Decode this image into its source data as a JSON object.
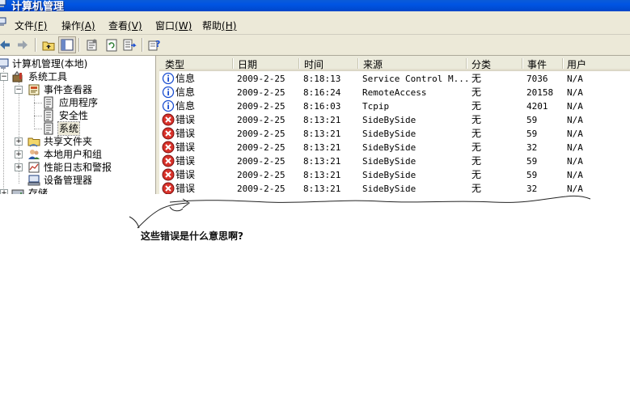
{
  "window": {
    "title": "计算机管理"
  },
  "menu": [
    {
      "label": "文件",
      "accel": "(F)"
    },
    {
      "label": "操作",
      "accel": "(A)"
    },
    {
      "label": "查看",
      "accel": "(V)"
    },
    {
      "label": "窗口",
      "accel": "(W)"
    },
    {
      "label": "帮助",
      "accel": "(H)"
    }
  ],
  "toolbar": {
    "buttons": [
      "back-icon",
      "forward-icon",
      "up-folder-icon",
      "show-tree-icon",
      "properties-icon",
      "refresh-icon",
      "export-list-icon",
      "help-icon"
    ]
  },
  "tree": {
    "items": [
      {
        "label": "计算机管理(本地)",
        "icon": "computer-management-icon"
      },
      {
        "label": "系统工具",
        "icon": "system-tools-icon"
      },
      {
        "label": "事件查看器",
        "icon": "event-viewer-icon"
      },
      {
        "label": "应用程序",
        "icon": "log-icon"
      },
      {
        "label": "安全性",
        "icon": "log-icon"
      },
      {
        "label": "系统",
        "icon": "log-icon"
      },
      {
        "label": "共享文件夹",
        "icon": "shared-folder-icon"
      },
      {
        "label": "本地用户和组",
        "icon": "users-icon"
      },
      {
        "label": "性能日志和警报",
        "icon": "performance-icon"
      },
      {
        "label": "设备管理器",
        "icon": "device-manager-icon"
      },
      {
        "label": "存储",
        "icon": "storage-icon"
      }
    ],
    "selected": "系统"
  },
  "list": {
    "columns": [
      "类型",
      "日期",
      "时间",
      "来源",
      "分类",
      "事件",
      "用户"
    ],
    "rows": [
      {
        "icon": "info-icon",
        "type": "信息",
        "date": "2009-2-25",
        "time": "8:18:13",
        "source": "Service Control M...",
        "category": "无",
        "event": "7036",
        "user": "N/A"
      },
      {
        "icon": "info-icon",
        "type": "信息",
        "date": "2009-2-25",
        "time": "8:16:24",
        "source": "RemoteAccess",
        "category": "无",
        "event": "20158",
        "user": "N/A"
      },
      {
        "icon": "info-icon",
        "type": "信息",
        "date": "2009-2-25",
        "time": "8:16:03",
        "source": "Tcpip",
        "category": "无",
        "event": "4201",
        "user": "N/A"
      },
      {
        "icon": "error-icon",
        "type": "错误",
        "date": "2009-2-25",
        "time": "8:13:21",
        "source": "SideBySide",
        "category": "无",
        "event": "59",
        "user": "N/A"
      },
      {
        "icon": "error-icon",
        "type": "错误",
        "date": "2009-2-25",
        "time": "8:13:21",
        "source": "SideBySide",
        "category": "无",
        "event": "59",
        "user": "N/A"
      },
      {
        "icon": "error-icon",
        "type": "错误",
        "date": "2009-2-25",
        "time": "8:13:21",
        "source": "SideBySide",
        "category": "无",
        "event": "32",
        "user": "N/A"
      },
      {
        "icon": "error-icon",
        "type": "错误",
        "date": "2009-2-25",
        "time": "8:13:21",
        "source": "SideBySide",
        "category": "无",
        "event": "59",
        "user": "N/A"
      },
      {
        "icon": "error-icon",
        "type": "错误",
        "date": "2009-2-25",
        "time": "8:13:21",
        "source": "SideBySide",
        "category": "无",
        "event": "59",
        "user": "N/A"
      },
      {
        "icon": "error-icon",
        "type": "错误",
        "date": "2009-2-25",
        "time": "8:13:21",
        "source": "SideBySide",
        "category": "无",
        "event": "32",
        "user": "N/A"
      }
    ]
  },
  "annotation": {
    "text": "这些错误是什么意思啊?"
  },
  "colors": {
    "titlebar": "#0054e3",
    "chrome": "#ece9d8",
    "error_red": "#d8322a",
    "info_blue": "#1c4fd1"
  }
}
